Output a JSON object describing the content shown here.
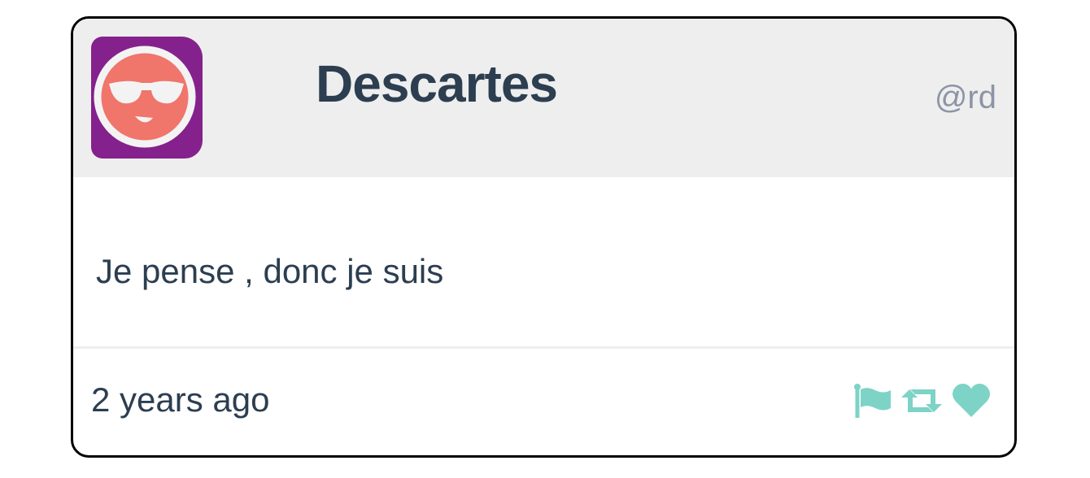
{
  "tweet": {
    "avatar_icon": "cool-face-sunglasses-icon",
    "name": "Descartes",
    "handle": "@rd",
    "message": "Je pense , donc je suis",
    "timestamp": "2 years ago",
    "actions": [
      {
        "icon": "flag-icon"
      },
      {
        "icon": "retweet-icon"
      },
      {
        "icon": "heart-icon"
      }
    ]
  },
  "colors": {
    "avatar_bg": "#85218c",
    "avatar_face": "#f0756b",
    "text": "#2c3e50",
    "handle": "#8b95a6",
    "header_bg": "#eeeeee",
    "action_icons": "#7dd3c6"
  }
}
